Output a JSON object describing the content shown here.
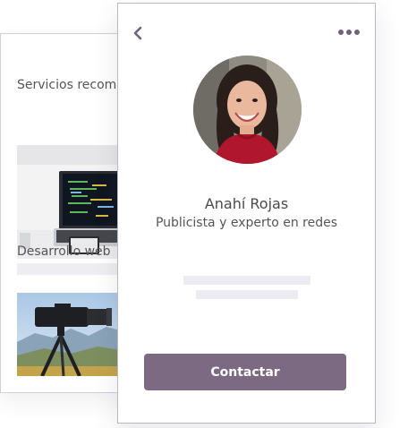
{
  "colors": {
    "accent": "#7c6a82",
    "icon": "#72627d",
    "text": "#555555",
    "placeholder": "#ececf0"
  },
  "back_card": {
    "section_title": "Servicios recomendados",
    "item_caption": "Desarrollo web",
    "images": [
      "laptop-code-photo",
      "camera-tripod-photo"
    ]
  },
  "profile": {
    "name": "Anahí Rojas",
    "role": "Publicista y experto en redes",
    "contact_label": "Contactar",
    "avatar": "portrait-photo"
  },
  "icons": {
    "back": "chevron-left-icon",
    "more": "more-dots-icon"
  }
}
